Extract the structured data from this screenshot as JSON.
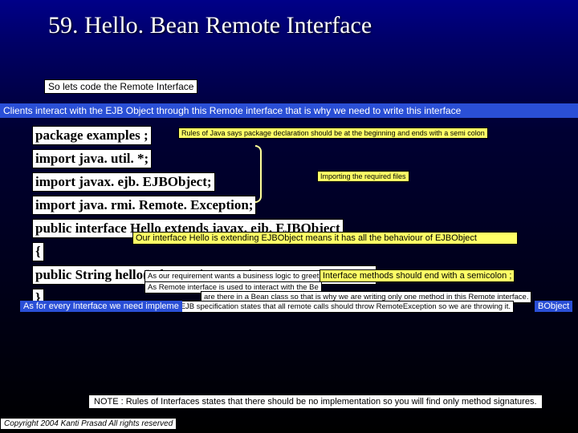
{
  "title": "59. Hello. Bean Remote Interface",
  "intro": "So lets code the Remote Interface",
  "banner": "Clients interact with the EJB Object through this Remote  interface that is why we need to write this interface",
  "code": {
    "l1": "package examples ;",
    "l2": "import java. util. *;",
    "l3": "import javax. ejb. EJBObject;",
    "l4": "import java. rmi. Remote. Exception;",
    "l5": "public interface Hello extends javax. ejb. EJBObject",
    "l6": "{",
    "l7": "public String hello() throws java. rmi. Remote. Exception;",
    "l8": "}"
  },
  "notes": {
    "n1": "Rules of Java says package declaration  should be  at the beginning and ends with a semi colon",
    "n2": "Importing the required files",
    "n3": "Our interface Hello is extending EJBObject means it has all the behaviour of EJBObject",
    "n4a": "As our requirement wants a business logic to greet",
    "n4b": "Interface methods should end with a semicolon ;",
    "n4c": "As Remote interface is used to interact with the Be",
    "n4d": "are there in a Bean class so that is why we are writing  only one method in  this Remote interface.",
    "n4e": "Note EJB specification states that all remote calls  should throw RemoteException so we are throwing it."
  },
  "bluesubs": {
    "b1": "As for every Interface we need impleme",
    "b2": "BObject"
  },
  "bottom": "NOTE :  Rules of Interfaces states that  there should be no implementation  so you will find only method signatures.",
  "copyright": "Copyright 2004 Kanti Prasad All rights reserved"
}
